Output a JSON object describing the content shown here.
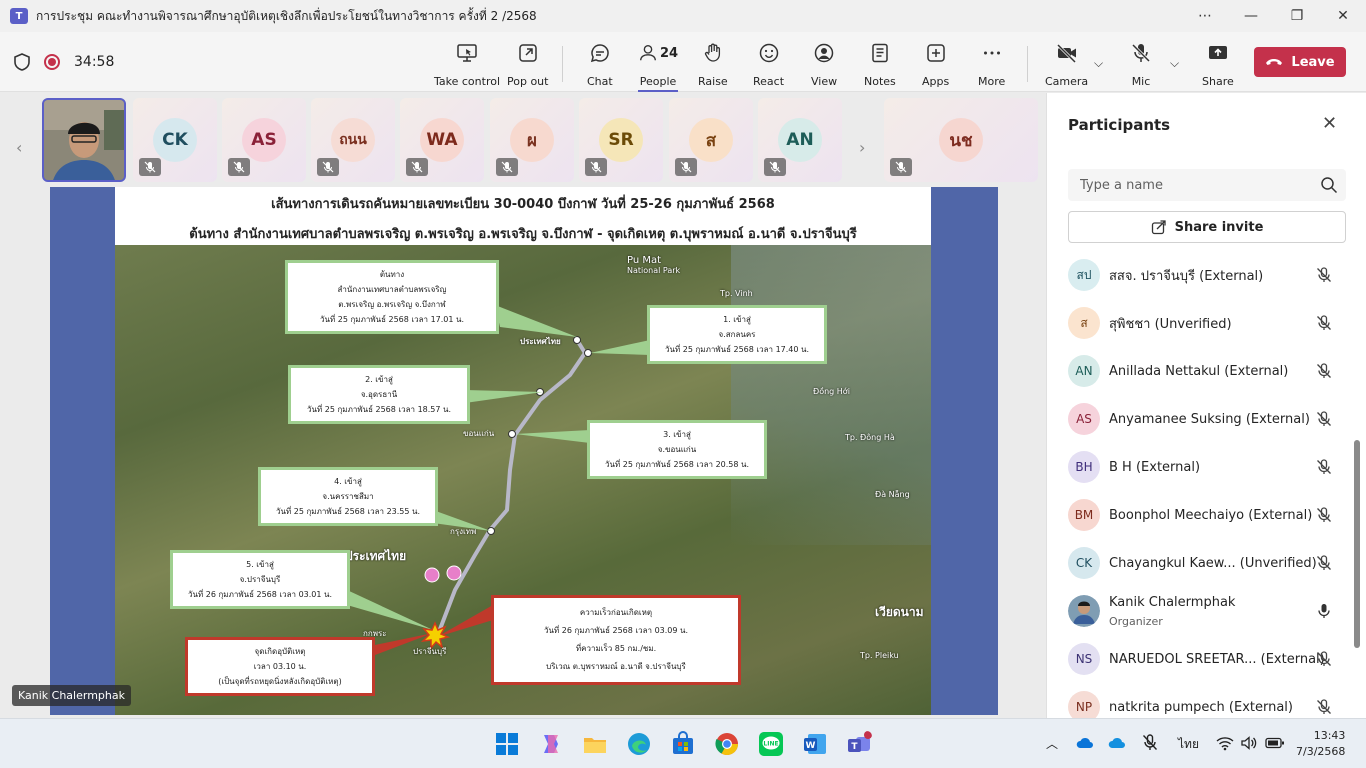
{
  "window": {
    "title": "การประชุม คณะทำงานพิจารณาศึกษาอุบัติเหตุเชิงลึกเพื่อประโยชน์ในทางวิชาการ ครั้งที่ 2 /2568",
    "controls": [
      "⋯",
      "—",
      "❐",
      "✕"
    ]
  },
  "toolbar": {
    "timer": "34:58",
    "take_control": "Take control",
    "pop_out": "Pop out",
    "chat": "Chat",
    "people": "People",
    "people_count": "24",
    "raise": "Raise",
    "react": "React",
    "view": "View",
    "notes": "Notes",
    "apps": "Apps",
    "more": "More",
    "camera": "Camera",
    "mic": "Mic",
    "share": "Share",
    "leave": "Leave"
  },
  "strip": {
    "tiles": [
      {
        "initials": "CK",
        "bg": "#d6e8ee",
        "fg": "#1f4e5f"
      },
      {
        "initials": "AS",
        "bg": "#f6d3dc",
        "fg": "#8a2138"
      },
      {
        "initials": "ถนน",
        "bg": "#f6dcd5",
        "fg": "#7a2f1f"
      },
      {
        "initials": "WA",
        "bg": "#f7d7d0",
        "fg": "#7d2a1c"
      },
      {
        "initials": "ผ",
        "bg": "#f7d9cf",
        "fg": "#7a3220"
      },
      {
        "initials": "SR",
        "bg": "#f5e6b8",
        "fg": "#6b4b07"
      },
      {
        "initials": "ส",
        "bg": "#f9e0c8",
        "fg": "#7a4312"
      },
      {
        "initials": "AN",
        "bg": "#d7ebe9",
        "fg": "#1d5d58"
      },
      {
        "initials": "นช",
        "bg": "#f6d6d0",
        "fg": "#7e2c20"
      }
    ],
    "presenter_name": "Kanik Chalermphak"
  },
  "slide": {
    "title_line1": "เส้นทางการเดินรถคันหมายเลขทะเบียน 30-0040 บึงกาฬ วันที่ 25-26 กุมภาพันธ์ 2568",
    "title_line2": "ต้นทาง สำนักงานเทศบาลตำบลพรเจริญ ต.พรเจริญ อ.พรเจริญ จ.บึงกาฬ - จุดเกิดเหตุ ต.บุพราหมณ์ อ.นาดี จ.ปราจีนบุรี",
    "map_labels": {
      "pu_mat": "Pu Mat",
      "pu_mat_park": "National Park",
      "vinh": "Tp. Vinh",
      "prathet_thai_top": "ประเทศไทย",
      "prathet_thai": "ประเทศไทย",
      "vietnam": "เวียดนาม",
      "dong_hoi": "Đồng Hới",
      "dong_ha": "Tp. Đông Hà",
      "da_nang": "Đà Nẵng",
      "pleiku": "Tp. Pleiku",
      "kok_phra": "กกพระ",
      "bangkok": "กรุงเทพ",
      "khon_kaen": "ขอนแก่น",
      "nakhon": "นครราชสีมา",
      "prachin": "ปราจีนบุรี"
    },
    "callouts": {
      "origin": [
        "ต้นทาง",
        "สำนักงานเทศบาลตำบลพรเจริญ",
        "ต.พรเจริญ อ.พรเจริญ จ.บึงกาฬ",
        "วันที่ 25 กุมภาพันธ์ 2568 เวลา 17.01 น."
      ],
      "c1": [
        "1. เข้าสู่",
        "จ.สกลนคร",
        "วันที่ 25 กุมภาพันธ์ 2568 เวลา 17.40 น."
      ],
      "c2": [
        "2. เข้าสู่",
        "จ.อุดรธานี",
        "วันที่ 25 กุมภาพันธ์ 2568 เวลา 18.57 น."
      ],
      "c3": [
        "3. เข้าสู่",
        "จ.ขอนแก่น",
        "วันที่ 25 กุมภาพันธ์ 2568 เวลา 20.58 น."
      ],
      "c4": [
        "4. เข้าสู่",
        "จ.นครราชสีมา",
        "วันที่ 25 กุมภาพันธ์ 2568 เวลา 23.55 น."
      ],
      "c5": [
        "5. เข้าสู่",
        "จ.ปราจีนบุรี",
        "วันที่ 26 กุมภาพันธ์ 2568 เวลา 03.01 น."
      ],
      "accident": [
        "จุดเกิดอุบัติเหตุ",
        "เวลา 03.10 น.",
        "(เป็นจุดที่รถหยุดนิ่งหลังเกิดอุบัติเหตุ)"
      ],
      "speed": [
        "ความเร็วก่อนเกิดเหตุ",
        "วันที่ 26 กุมภาพันธ์ 2568 เวลา 03.09 น.",
        "ที่ความเร็ว 85 กม./ชม.",
        "บริเวณ ต.บุพราหมณ์ อ.นาดี จ.ปราจีนบุรี"
      ]
    }
  },
  "panel": {
    "title": "Participants",
    "search_placeholder": "Type a name",
    "share_invite": "Share invite",
    "participants": [
      {
        "initials": "สป",
        "name": "สสจ. ปราจีนบุรี (External)",
        "bg": "#d9edf0",
        "fg": "#1f5360",
        "muted": true
      },
      {
        "initials": "ส",
        "name": "สุพิชชา (Unverified)",
        "bg": "#fbe4cf",
        "fg": "#7a4312",
        "muted": true
      },
      {
        "initials": "AN",
        "name": "Anillada Nettakul (External)",
        "bg": "#d7ebe9",
        "fg": "#1d5d58",
        "muted": true
      },
      {
        "initials": "AS",
        "name": "Anyamanee Suksing (External)",
        "bg": "#f6d3dc",
        "fg": "#8a2138",
        "muted": true
      },
      {
        "initials": "BH",
        "name": "B H (External)",
        "bg": "#e4dff3",
        "fg": "#3e2d7a",
        "muted": true
      },
      {
        "initials": "BM",
        "name": "Boonphol Meechaiyo (External)",
        "bg": "#f7d7d0",
        "fg": "#7d2a1c",
        "muted": true
      },
      {
        "initials": "CK",
        "name": "Chayangkul Kaew...   (Unverified)",
        "bg": "#d6e8ee",
        "fg": "#1f4e5f",
        "muted": true
      },
      {
        "initials": "",
        "name": "Kanik Chalermphak",
        "role": "Organizer",
        "bg": "#6b8fa8",
        "fg": "#fff",
        "muted": false
      },
      {
        "initials": "NS",
        "name": "NARUEDOL SREETAR... (External)",
        "bg": "#e3e0f2",
        "fg": "#3d3375",
        "muted": true
      },
      {
        "initials": "NP",
        "name": "natkrita pumpech (External)",
        "bg": "#f6dcd5",
        "fg": "#7a2f1f",
        "muted": true
      }
    ]
  },
  "taskbar": {
    "lang": "ไทย",
    "time": "13:43",
    "date": "7/3/2568"
  },
  "colors": {
    "accent": "#5b5fc7",
    "leave": "#c4314b",
    "slide_bg": "#5066a8"
  }
}
